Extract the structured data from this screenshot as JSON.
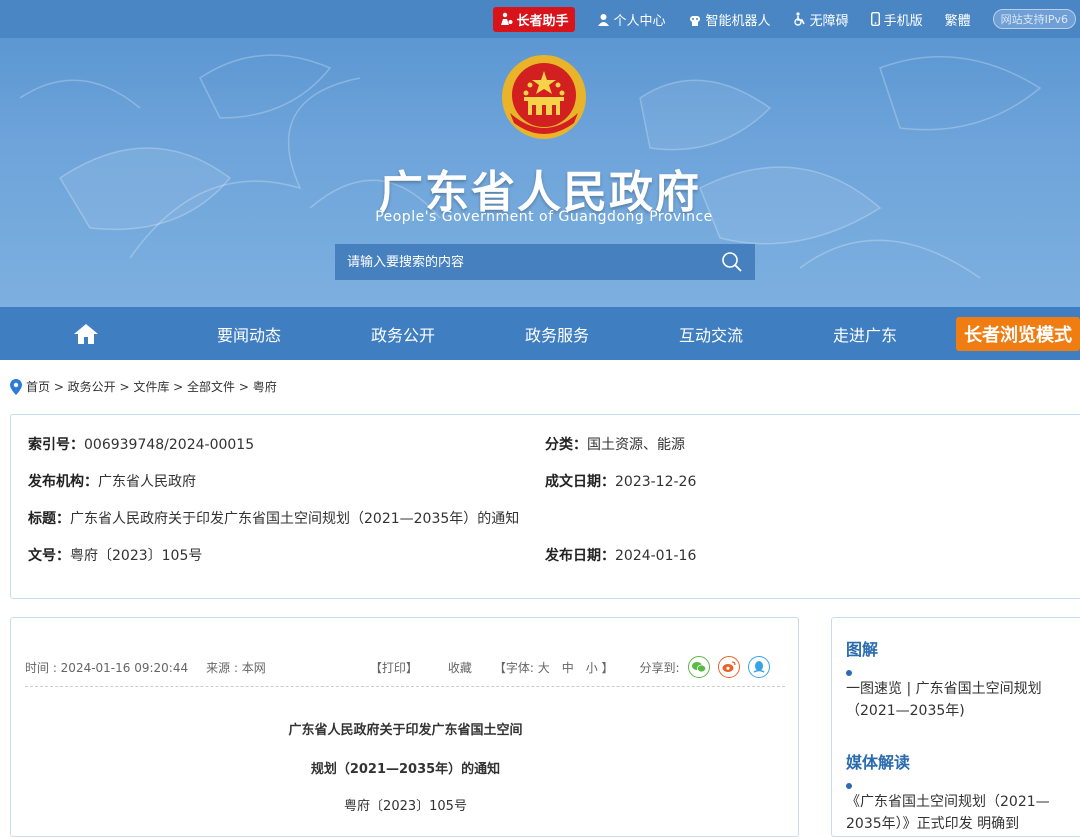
{
  "topbar": {
    "elder_assistant": "长者助手",
    "personal_center": "个人中心",
    "robot": "智能机器人",
    "accessibility": "无障碍",
    "mobile": "手机版",
    "traditional": "繁體",
    "ipv6": "网站支持IPv6"
  },
  "header": {
    "title": "广东省人民政府",
    "subtitle": "People's Government of Guangdong Province",
    "search_placeholder": "请输入要搜索的内容"
  },
  "nav": {
    "items": [
      "要闻动态",
      "政务公开",
      "政务服务",
      "互动交流",
      "走进广东"
    ],
    "elder_mode": "长者浏览模式"
  },
  "breadcrumb": "首页 > 政务公开 > 文件库 > 全部文件 > 粤府",
  "info": {
    "index_label": "索引号：",
    "index_value": "006939748/2024-00015",
    "category_label": "分类：",
    "category_value": "国土资源、能源",
    "issuer_label": "发布机构：",
    "issuer_value": "广东省人民政府",
    "written_label": "成文日期：",
    "written_value": "2023-12-26",
    "title_label": "标题：",
    "title_value": "广东省人民政府关于印发广东省国土空间规划（2021—2035年）的通知",
    "docno_label": "文号：",
    "docno_value": "粤府〔2023〕105号",
    "published_label": "发布日期：",
    "published_value": "2024-01-16"
  },
  "article": {
    "time": "时间 : 2024-01-16 09:20:44",
    "source": "来源 : 本网",
    "print": "【打印】",
    "favorite": "收藏",
    "font": "【字体: 大　中　小 】",
    "share": "分享到:",
    "title_line1": "广东省人民政府关于印发广东省国土空间",
    "title_line2": "规划（2021—2035年）的通知",
    "doc_number": "粤府〔2023〕105号"
  },
  "sidebar": {
    "section1": "图解",
    "item1": "一图速览 | 广东省国土空间规划（2021—2035年)",
    "section2": "媒体解读",
    "item2": "《广东省国土空间规划（2021—2035年）》正式印发 明确到"
  },
  "colors": {
    "topbar": "#4a86c4",
    "nav": "#3f7ec0",
    "elder_red": "#d8131a",
    "elder_orange": "#f07d12",
    "accent_blue": "#2b6cb0"
  }
}
